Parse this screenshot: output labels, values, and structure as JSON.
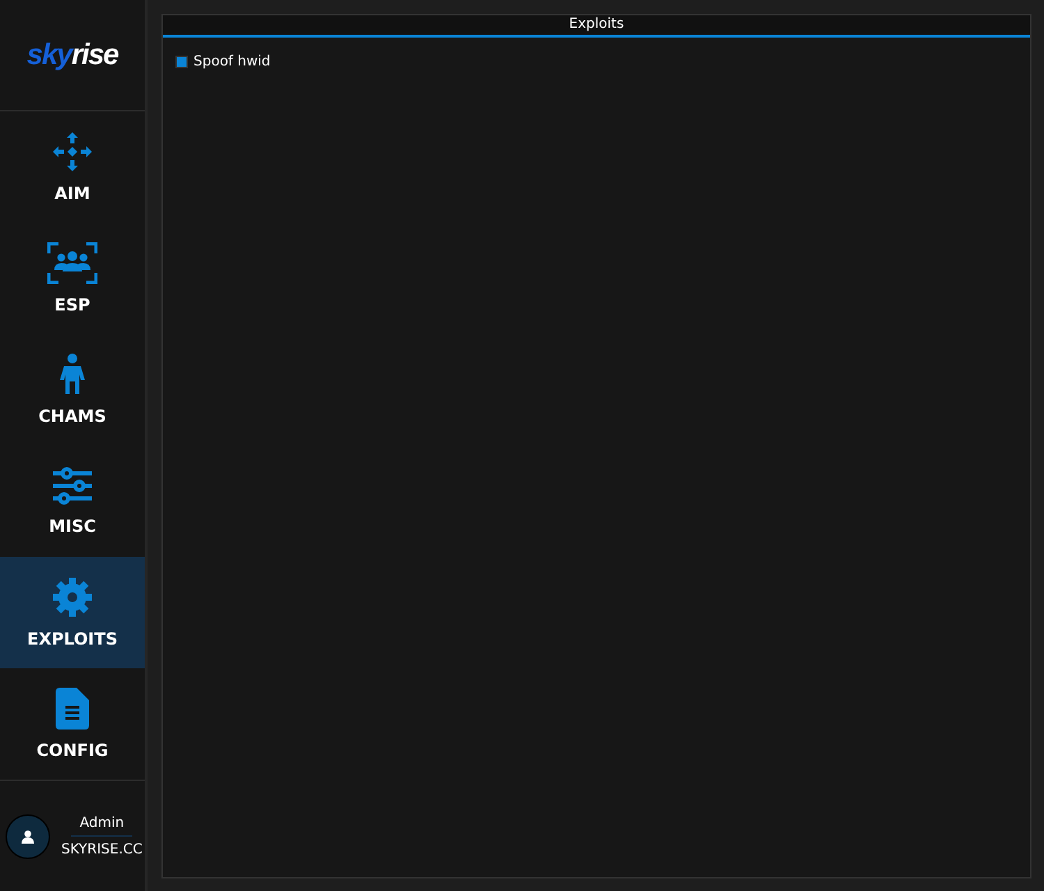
{
  "logo": {
    "first": "sky",
    "second": "rise"
  },
  "nav": [
    {
      "label": "AIM",
      "selected": false
    },
    {
      "label": "ESP",
      "selected": false
    },
    {
      "label": "CHAMS",
      "selected": false
    },
    {
      "label": "MISC",
      "selected": false
    },
    {
      "label": "EXPLOITS",
      "selected": true
    },
    {
      "label": "CONFIG",
      "selected": false
    }
  ],
  "user": {
    "name": "Admin",
    "site": "SKYRISE.CC"
  },
  "panel": {
    "title": "Exploits",
    "options": [
      {
        "label": "Spoof hwid",
        "checked": true
      }
    ]
  }
}
